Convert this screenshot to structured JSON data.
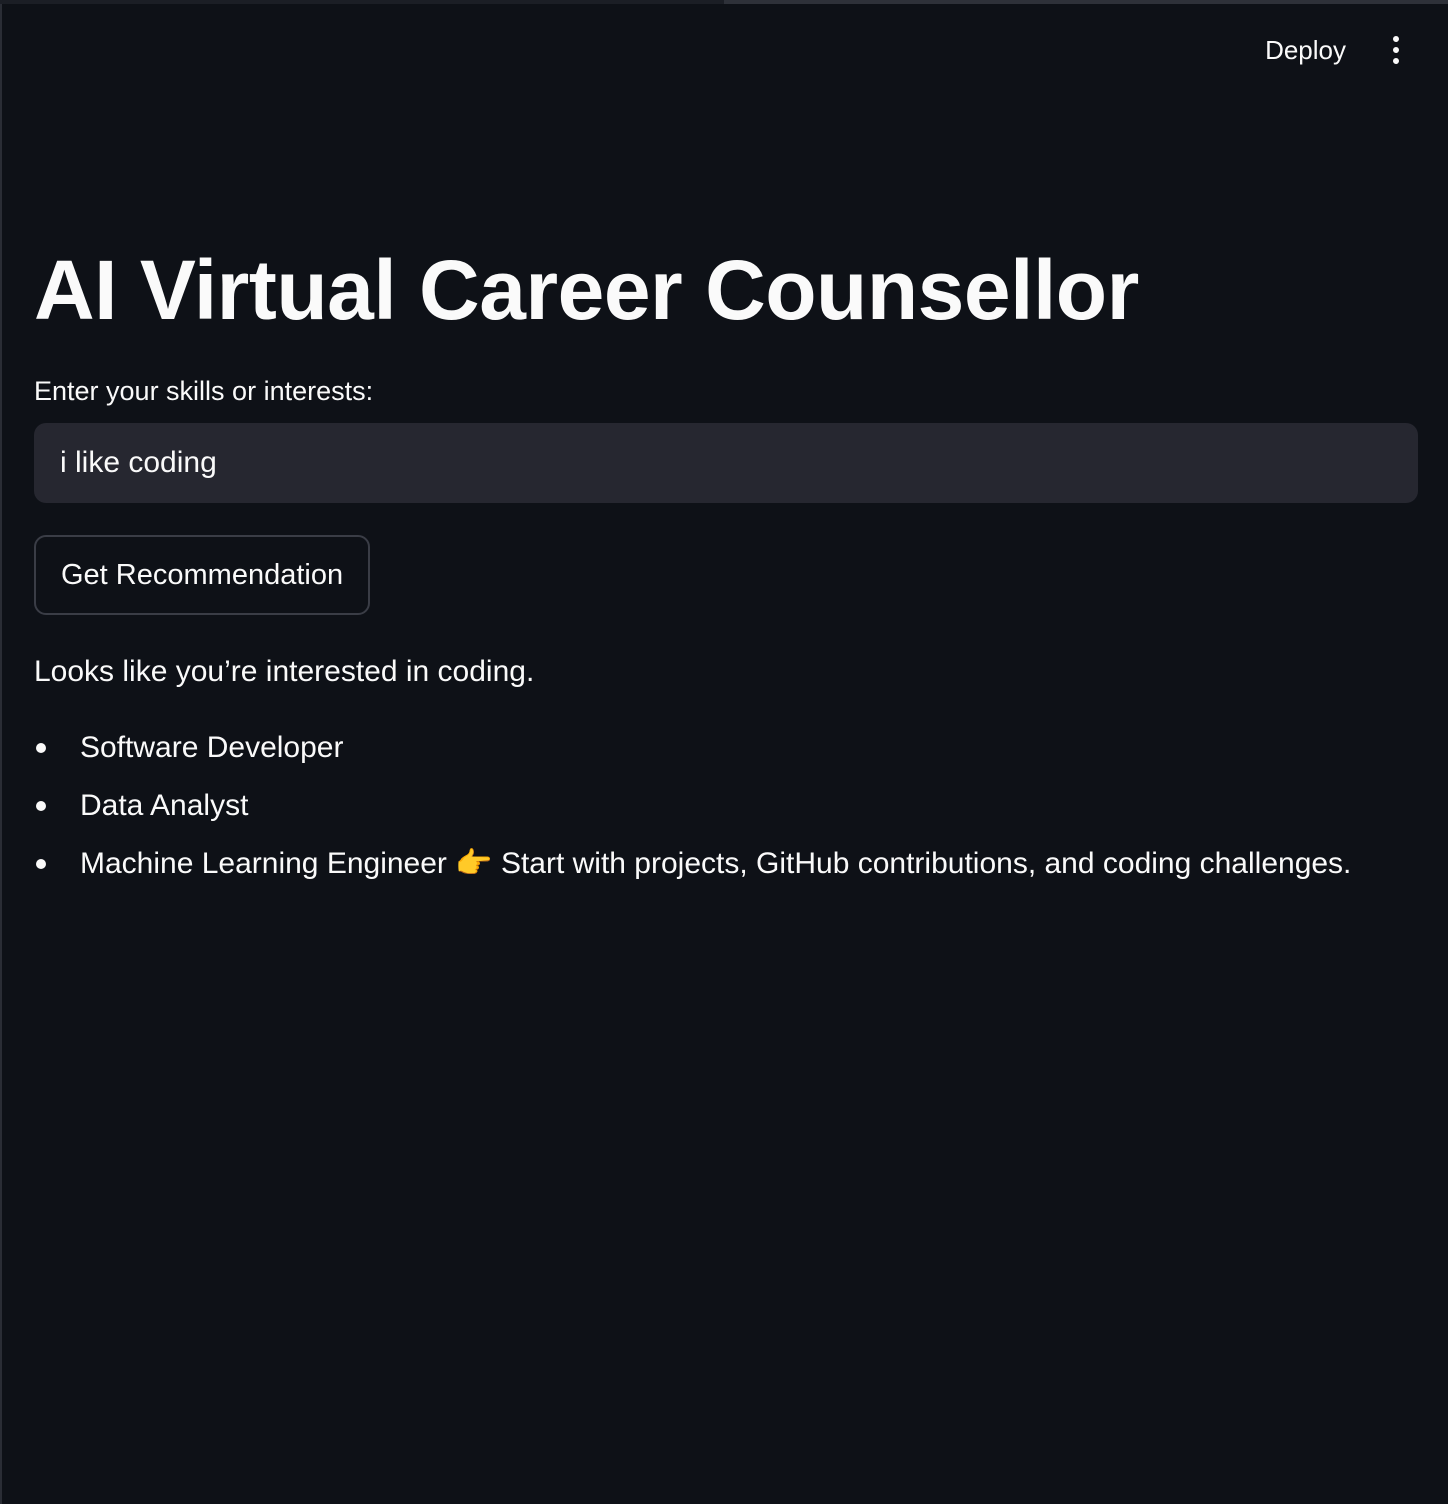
{
  "header": {
    "deploy_label": "Deploy",
    "menu_icon": "vertical-ellipsis-icon"
  },
  "main": {
    "title": "AI Virtual Career Counsellor",
    "input_label": "Enter your skills or interests:",
    "input_value": "i like coding",
    "button_label": "Get Recommendation",
    "result_intro": "Looks like you’re interested in coding.",
    "recommendations": [
      "Software Developer",
      "Data Analyst",
      "Machine Learning Engineer 👉 Start with projects, GitHub contributions, and coding challenges."
    ]
  },
  "colors": {
    "background": "#0e1117",
    "input_bg": "#262730",
    "text": "#fafafa",
    "button_border": "#3a3d46"
  }
}
